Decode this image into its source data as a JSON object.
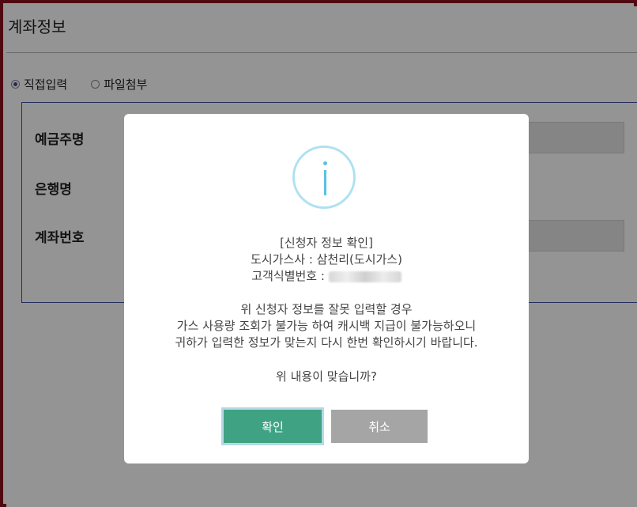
{
  "page": {
    "title": "계좌정보",
    "radio_options": [
      {
        "label": "직접입력",
        "selected": true
      },
      {
        "label": "파일첨부",
        "selected": false
      }
    ],
    "form_labels": [
      "예금주명",
      "은행명",
      "계좌번호"
    ]
  },
  "modal": {
    "heading": "[신청자 정보 확인]",
    "company_line": "도시가스사 : 삼천리(도시가스)",
    "customer_label": "고객식별번호 :",
    "warning_lines": [
      "위 신청자 정보를 잘못 입력할 경우",
      "가스 사용량 조회가 불가능 하여 캐시백 지급이 불가능하오니",
      "귀하가 입력한 정보가 맞는지 다시 한번 확인하시기 바랍니다."
    ],
    "question": "위 내용이 맞습니까?",
    "confirm_label": "확인",
    "cancel_label": "취소",
    "icon": "info-icon"
  },
  "colors": {
    "frame": "#8a0f1e",
    "confirm": "#3fa383",
    "cancel": "#a5a5a5",
    "icon": "#58c2e6"
  }
}
